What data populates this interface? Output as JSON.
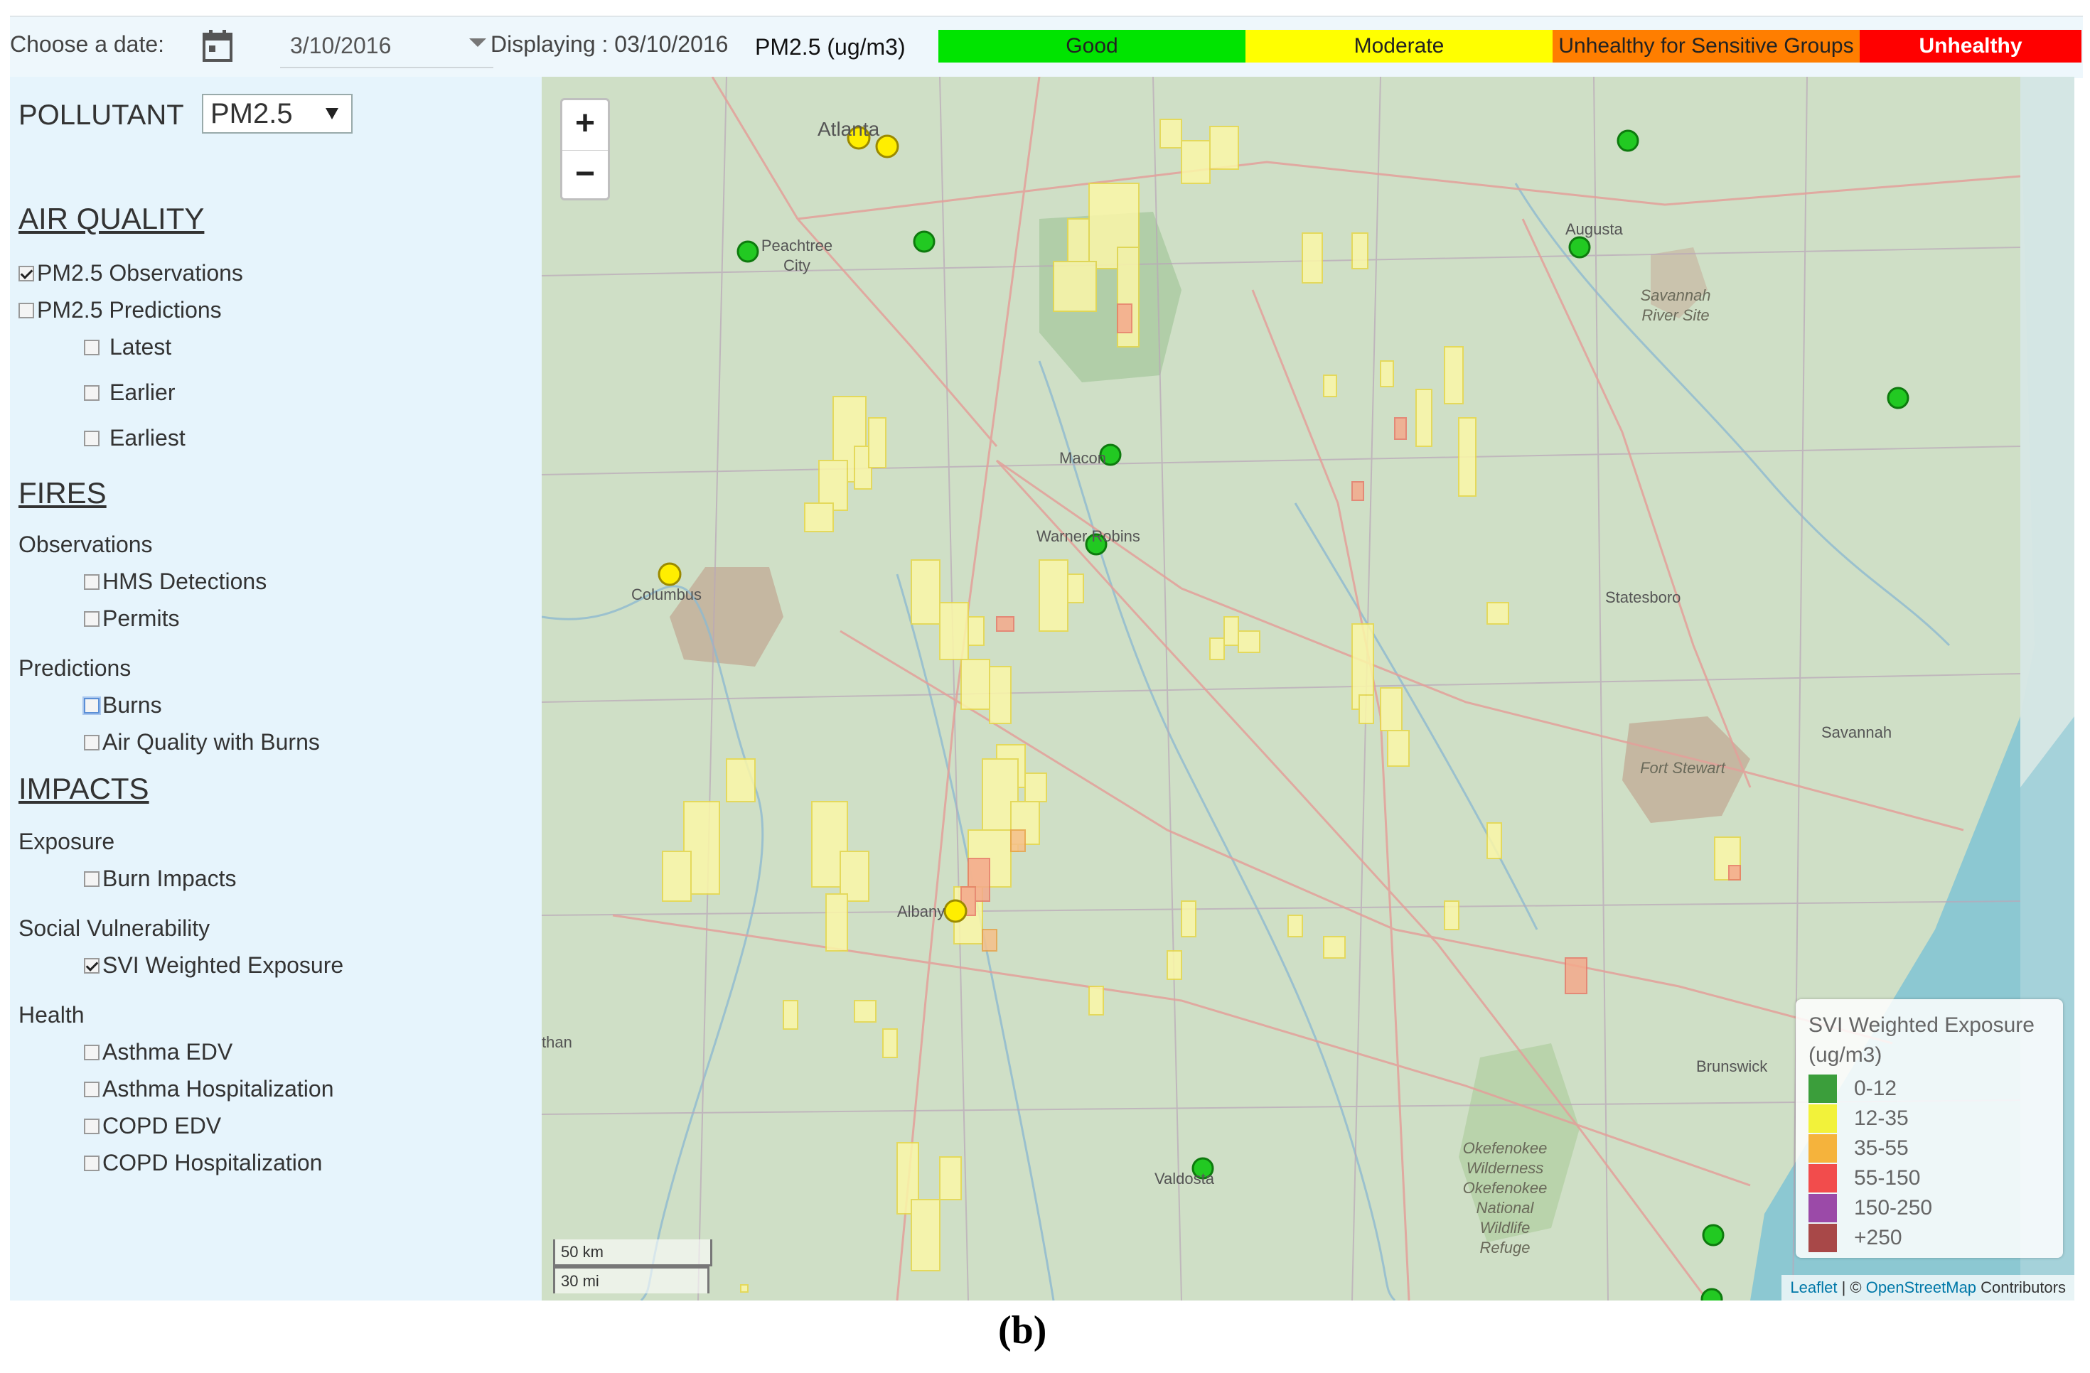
{
  "header": {
    "choose_date_label": "Choose a date:",
    "date_value": "3/10/2016",
    "displaying_label": "Displaying : 03/10/2016",
    "pollutant_unit": "PM2.5 (ug/m3)",
    "scale": [
      {
        "label": "Good",
        "color": "#00e400",
        "text_color": "#222222"
      },
      {
        "label": "Moderate",
        "color": "#ffff00",
        "text_color": "#222222"
      },
      {
        "label": "Unhealthy for Sensitive Groups",
        "color": "#ff7e00",
        "text_color": "#222222"
      },
      {
        "label": "Unhealthy",
        "color": "#ff0000",
        "text_color": "#ffffff"
      }
    ],
    "calendar_icon": "calendar-icon"
  },
  "sidebar": {
    "pollutant_label": "POLLUTANT",
    "pollutant_value": "PM2.5",
    "air_quality": {
      "heading": "AIR QUALITY",
      "items": [
        {
          "label": "PM2.5 Observations",
          "checked": true
        },
        {
          "label": "PM2.5 Predictions",
          "checked": false
        },
        {
          "label": "Latest",
          "checked": false
        },
        {
          "label": "Earlier",
          "checked": false
        },
        {
          "label": "Earliest",
          "checked": false
        }
      ]
    },
    "fires": {
      "heading": "FIRES",
      "observations_label": "Observations",
      "observations": [
        {
          "label": "HMS Detections",
          "checked": false
        },
        {
          "label": "Permits",
          "checked": false
        }
      ],
      "predictions_label": "Predictions",
      "predictions": [
        {
          "label": "Burns",
          "checked": false
        },
        {
          "label": "Air Quality with Burns",
          "checked": false
        }
      ]
    },
    "impacts": {
      "heading": "IMPACTS",
      "exposure_label": "Exposure",
      "exposure": [
        {
          "label": "Burn Impacts",
          "checked": false
        }
      ],
      "social_label": "Social Vulnerability",
      "social": [
        {
          "label": "SVI Weighted Exposure",
          "checked": true
        }
      ],
      "health_label": "Health",
      "health": [
        {
          "label": "Asthma EDV",
          "checked": false
        },
        {
          "label": "Asthma Hospitalization",
          "checked": false
        },
        {
          "label": "COPD EDV",
          "checked": false
        },
        {
          "label": "COPD Hospitalization",
          "checked": false
        }
      ]
    }
  },
  "map": {
    "zoom_in": "+",
    "zoom_out": "−",
    "cities": {
      "atlanta": "Atlanta",
      "peachtree": "Peachtree City",
      "augusta": "Augusta",
      "macon": "Macon",
      "warner_robins": "Warner Robins",
      "columbus": "Columbus",
      "statesboro": "Statesboro",
      "savannah": "Savannah",
      "albany": "Albany",
      "brunswick": "Brunswick",
      "valdosta": "Valdosta",
      "fort_stewart": "Fort Stewart",
      "savannah_river": "Savannah River Site",
      "okefenokee": "Okefenokee Wilderness Okefenokee National Wildlife Refuge",
      "than": "than"
    },
    "legend": {
      "title": "SVI Weighted Exposure (ug/m3)",
      "items": [
        {
          "label": "0-12",
          "color": "#3b9e3b"
        },
        {
          "label": "12-35",
          "color": "#f2f23a"
        },
        {
          "label": "35-55",
          "color": "#f5b33c"
        },
        {
          "label": "55-150",
          "color": "#f24c4c"
        },
        {
          "label": "150-250",
          "color": "#9b4aa8"
        },
        {
          "label": "+250",
          "color": "#a84848"
        }
      ]
    },
    "scale_km": "50 km",
    "scale_mi": "30 mi",
    "attribution_leaflet": "Leaflet",
    "attribution_sep": " | © ",
    "attribution_osm": "OpenStreetMap",
    "attribution_rest": " Contributors"
  },
  "caption": "(b)"
}
